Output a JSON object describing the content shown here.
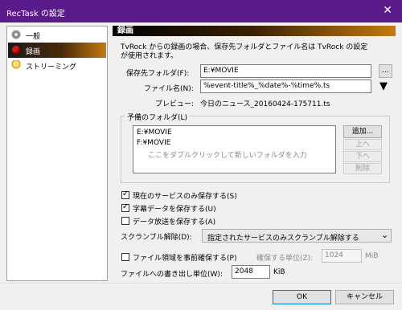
{
  "window": {
    "title": "RecTask の設定",
    "close_glyph": "✕"
  },
  "sidebar": {
    "items": [
      {
        "label": "一般",
        "icon": "gear-icon"
      },
      {
        "label": "録画",
        "icon": "record-icon",
        "selected": true
      },
      {
        "label": "ストリーミング",
        "icon": "bulb-icon"
      }
    ]
  },
  "section": {
    "header": "録画"
  },
  "description": {
    "line1": "TvRock からの録画の場合、保存先フォルダとファイル名は TvRock の設定",
    "line2": "が使用されます。"
  },
  "save_folder": {
    "label": "保存先フォルダ(F):",
    "value": "E:¥MOVIE",
    "browse_label": "..."
  },
  "file_name": {
    "label": "ファイル名(N):",
    "value": "%event-title%_%date%-%time%.ts",
    "menu_glyph": "▼"
  },
  "preview": {
    "label": "プレビュー:",
    "value": "今日のニュース_20160424-175711.ts"
  },
  "spare_folders": {
    "legend": "予備のフォルダ(L)",
    "items": [
      "E:¥MOVIE",
      "F:¥MOVIE"
    ],
    "hint": "ここをダブルクリックして新しいフォルダを入力",
    "add_label": "追加...",
    "up_label": "上へ",
    "down_label": "下へ",
    "delete_label": "削除"
  },
  "options": {
    "current_service_only": {
      "label": "現在のサービスのみ保存する(S)",
      "checked": true
    },
    "save_subtitles": {
      "label": "字幕データを保存する(U)",
      "checked": true
    },
    "save_data_broadcast": {
      "label": "データ放送を保存する(A)",
      "checked": false
    }
  },
  "scramble": {
    "label": "スクランブル解除(D):",
    "value": "指定されたサービスのみスクランブル解除する",
    "arrow": "⌄"
  },
  "preallocate": {
    "label": "ファイル領域を事前確保する(P)",
    "checked": false,
    "unit_label": "確保する単位(Z):",
    "unit_value": "1024",
    "unit_suffix": "MiB"
  },
  "write_unit": {
    "label": "ファイルへの書き出し単位(W):",
    "value": "2048",
    "suffix": "KiB"
  },
  "buttons": {
    "ok": "OK",
    "cancel": "キャンセル"
  }
}
